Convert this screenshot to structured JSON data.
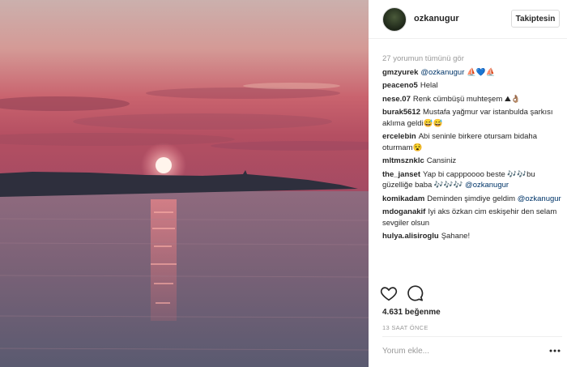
{
  "post": {
    "username": "ozkanugur",
    "follow_label": "Takiptesin",
    "load_more": "27 yorumun tümünü gör",
    "comments": [
      {
        "user": "gmzyurek",
        "text": "@ozkanugur ⛵💙⛵"
      },
      {
        "user": "peaceno5",
        "text": "Helal"
      },
      {
        "user": "nese.07",
        "text": "Renk cümbüşü muhteşem ⛰👌🏽"
      },
      {
        "user": "burak5612",
        "text": "Mustafa yağmur var istanbulda şarkısı aklıma geldi😅😅"
      },
      {
        "user": "ercelebin",
        "text": "Abi seninle birkere otursam bidaha oturmam😵"
      },
      {
        "user": "mltmsznklc",
        "text": "Cansiniz"
      },
      {
        "user": "the_janset",
        "text": "Yap bi capppoooo beste 🎶🎶bu güzelliğe baba 🎶🎶🎶",
        "mention": "@ozkanugur"
      },
      {
        "user": "komikadam",
        "text": "Deminden şimdiye geldim",
        "mention": "@ozkanugur"
      },
      {
        "user": "mdoganakif",
        "text": "Iyi aks özkan cim eskişehir den selam sevgiler olsun"
      },
      {
        "user": "hulya.alisiroglu",
        "text": "Şahane!"
      }
    ],
    "likes": "4.631 beğenme",
    "time": "13 SAAT ÖNCE",
    "comment_placeholder": "Yorum ekle..."
  },
  "icons": {
    "like": "heart-icon",
    "comment": "comment-bubble-icon",
    "more": "more-options-icon"
  },
  "colors": {
    "mention": "#003569",
    "muted": "#999999",
    "border": "#efefef",
    "sky_top": "#c8a8a8",
    "sun": "#fff2e6"
  }
}
